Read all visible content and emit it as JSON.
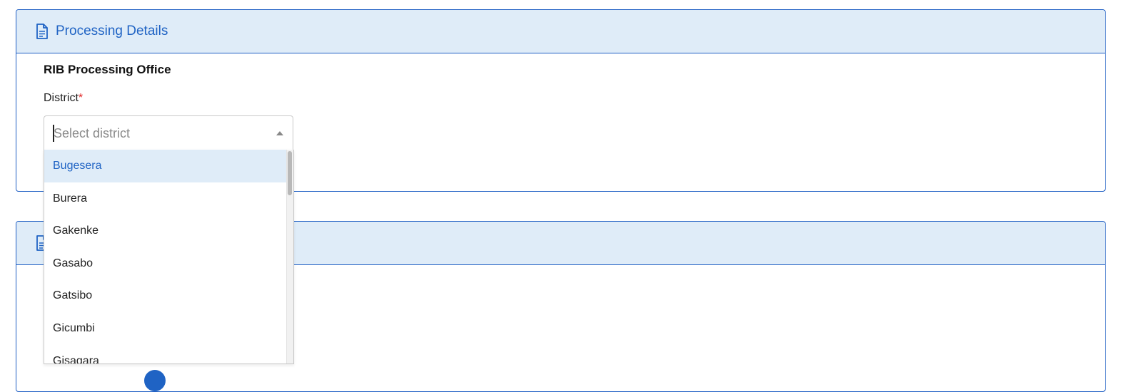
{
  "card1": {
    "title": "Processing Details",
    "icon": "document-icon",
    "section_title": "RIB Processing Office",
    "district_field": {
      "label": "District",
      "required_mark": "*",
      "placeholder": "Select district",
      "value": ""
    }
  },
  "dropdown": {
    "options": [
      "Bugesera",
      "Burera",
      "Gakenke",
      "Gasabo",
      "Gatsibo",
      "Gicumbi",
      "Gisagara"
    ],
    "highlighted": "Bugesera"
  },
  "card2": {
    "title": "",
    "icon": "document-icon"
  },
  "colors": {
    "accent": "#1f63c4",
    "header_bg": "#dfecf8",
    "required": "#e02424"
  }
}
